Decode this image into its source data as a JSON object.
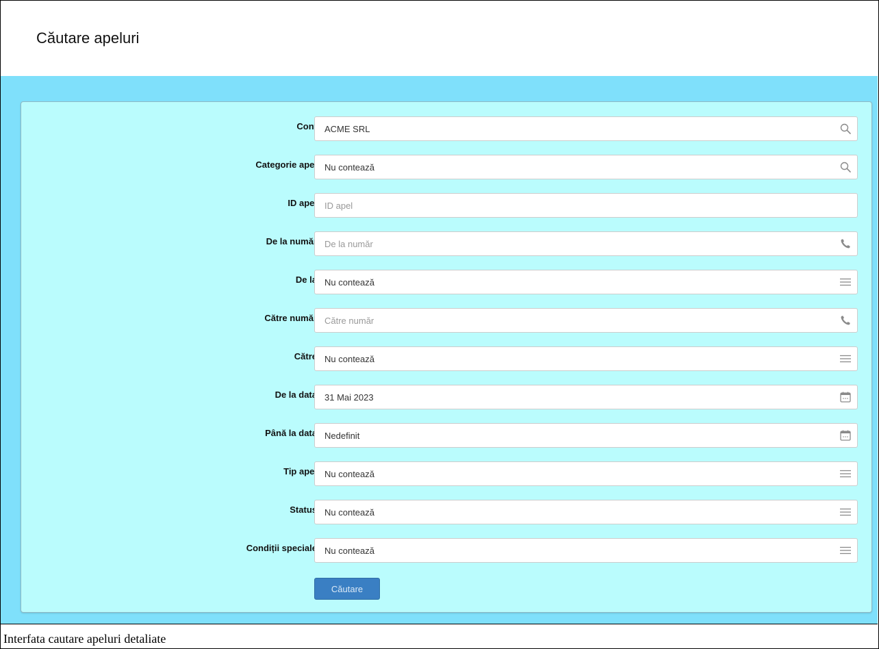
{
  "header": {
    "title": "Căutare apeluri"
  },
  "form": {
    "fields": [
      {
        "label": "Cont",
        "value": "ACME SRL",
        "placeholder": "",
        "icon": "search-icon"
      },
      {
        "label": "Categorie apel",
        "value": "Nu contează",
        "placeholder": "",
        "icon": "search-icon"
      },
      {
        "label": "ID apel",
        "value": "",
        "placeholder": "ID apel",
        "icon": ""
      },
      {
        "label": "De la număr",
        "value": "",
        "placeholder": "De la număr",
        "icon": "phone-icon"
      },
      {
        "label": "De la",
        "value": "Nu contează",
        "placeholder": "",
        "icon": "list-icon"
      },
      {
        "label": "Către număr",
        "value": "",
        "placeholder": "Către număr",
        "icon": "phone-icon"
      },
      {
        "label": "Către",
        "value": "Nu contează",
        "placeholder": "",
        "icon": "list-icon"
      },
      {
        "label": "De la data",
        "value": "31 Mai 2023",
        "placeholder": "",
        "icon": "calendar-icon"
      },
      {
        "label": "Până la data",
        "value": "Nedefinit",
        "placeholder": "",
        "icon": "calendar-icon"
      },
      {
        "label": "Tip apel",
        "value": "Nu contează",
        "placeholder": "",
        "icon": "list-icon"
      },
      {
        "label": "Status",
        "value": "Nu contează",
        "placeholder": "",
        "icon": "list-icon"
      },
      {
        "label": "Condiții speciale",
        "value": "Nu contează",
        "placeholder": "",
        "icon": "list-icon"
      }
    ],
    "submit_label": "Căutare"
  },
  "caption": {
    "text": "Interfata cautare apeluri detaliate"
  },
  "colors": {
    "background": "#7fe0fb",
    "panel": "#bafcfd",
    "button": "#3a7fc3"
  }
}
